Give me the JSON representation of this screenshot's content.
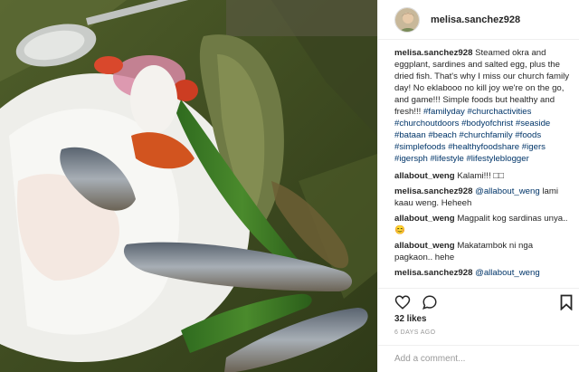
{
  "header": {
    "username": "melisa.sanchez928"
  },
  "caption": {
    "username": "melisa.sanchez928",
    "text": "Steamed okra and eggplant, sardines and salted egg, plus the dried fish. That's why I miss our church family day! No eklabooo no kill joy we're on the go, and game!!! Simple foods but healthy and fresh!!!",
    "hashtags": "#familyday #churchactivities #churchoutdoors #bodyofchrist #seaside #bataan #beach #churchfamily #foods #simplefoods #healthyfoodshare #igers #igersph #lifestyle #lifestyleblogger"
  },
  "comments": [
    {
      "username": "allabout_weng",
      "text": "Kalami!!! □□"
    },
    {
      "username": "melisa.sanchez928",
      "mention": "@allabout_weng",
      "text": "lami kaau weng. Heheeh"
    },
    {
      "username": "allabout_weng",
      "text": "Magpalit kog sardinas unya.. 😊"
    },
    {
      "username": "allabout_weng",
      "text": "Makatambok ni nga pagkaon.. hehe"
    },
    {
      "username": "melisa.sanchez928",
      "mention": "@allabout_weng",
      "text": ""
    }
  ],
  "actions": {
    "like_icon": "heart-icon",
    "comment_icon": "comment-icon",
    "save_icon": "bookmark-icon"
  },
  "likes": "32 likes",
  "time": "6 DAYS AGO",
  "add_comment": {
    "placeholder": "Add a comment..."
  },
  "colors": {
    "hashtag": "#003569",
    "muted": "#999999",
    "border": "#efefef"
  }
}
